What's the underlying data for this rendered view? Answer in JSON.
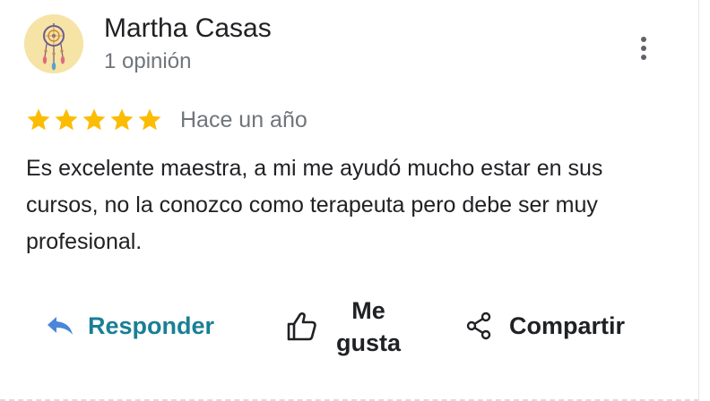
{
  "review": {
    "author_name": "Martha Casas",
    "author_meta": "1 opinión",
    "rating": 5,
    "rating_max": 5,
    "date": "Hace un año",
    "text": "Es excelente maestra, a mi me ayudó mucho estar en sus cursos, no la conozco como terapeuta pero debe ser muy profesional."
  },
  "actions": {
    "reply_label": "Responder",
    "like_label_line1": "Me",
    "like_label_line2": "gusta",
    "share_label": "Compartir"
  },
  "icons": {
    "menu": "more-vert-icon",
    "reply": "reply-arrow-icon",
    "like": "thumb-up-icon",
    "share": "share-icon",
    "star": "star-icon",
    "avatar": "dreamcatcher-avatar"
  },
  "colors": {
    "star": "#fbbc04",
    "reply_accent": "#1a7f95",
    "secondary_text": "#70757a",
    "avatar_bg": "#f6e3a6"
  }
}
